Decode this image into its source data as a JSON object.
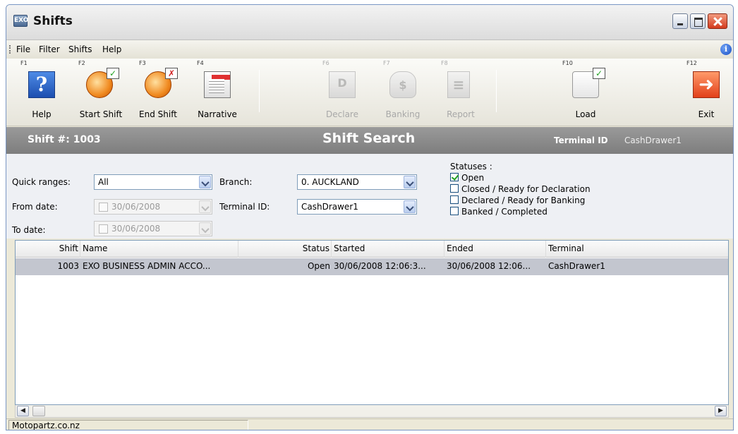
{
  "window": {
    "title": "Shifts",
    "app_icon_text": "EXO"
  },
  "menu": {
    "items": [
      "File",
      "Filter",
      "Shifts",
      "Help"
    ]
  },
  "toolbar": {
    "help": {
      "fkey": "F1",
      "label": "Help",
      "icon": "help-question-icon"
    },
    "start_shift": {
      "fkey": "F2",
      "label": "Start Shift",
      "badge": "✓",
      "icon": "start-shift-clock-icon"
    },
    "end_shift": {
      "fkey": "F3",
      "label": "End Shift",
      "badge": "✗",
      "icon": "end-shift-clock-icon"
    },
    "narrative": {
      "fkey": "F4",
      "label": "Narrative",
      "icon": "narrative-document-icon"
    },
    "declare": {
      "fkey": "F6",
      "label": "Declare",
      "glyph": "D",
      "icon": "declare-icon",
      "enabled": false
    },
    "banking": {
      "fkey": "F7",
      "label": "Banking",
      "glyph": "$",
      "icon": "banking-moneybag-icon",
      "enabled": false
    },
    "report": {
      "fkey": "F8",
      "label": "Report",
      "glyph": "≡",
      "icon": "report-icon",
      "enabled": false
    },
    "load": {
      "fkey": "F10",
      "label": "Load",
      "badge": "✓",
      "icon": "load-shift-icon"
    },
    "exit": {
      "fkey": "F12",
      "label": "Exit",
      "glyph": "➜",
      "icon": "exit-door-icon"
    }
  },
  "banner": {
    "shift_label": "Shift #: 1003",
    "title": "Shift Search",
    "terminal_label": "Terminal ID",
    "terminal_value": "CashDrawer1"
  },
  "filters": {
    "quick_ranges_label": "Quick ranges:",
    "quick_ranges_value": "All",
    "from_date_label": "From date:",
    "from_date_value": "30/06/2008",
    "to_date_label": "To date:",
    "to_date_value": "30/06/2008",
    "branch_label": "Branch:",
    "branch_value": "0. AUCKLAND",
    "terminal_label": "Terminal ID:",
    "terminal_value": "CashDrawer1",
    "statuses_label": "Statuses :",
    "statuses": [
      {
        "label": "Open",
        "checked": true
      },
      {
        "label": "Closed / Ready for Declaration",
        "checked": false
      },
      {
        "label": "Declared / Ready for Banking",
        "checked": false
      },
      {
        "label": "Banked / Completed",
        "checked": false
      }
    ]
  },
  "grid": {
    "columns": [
      "Shift",
      "Name",
      "Status",
      "Started",
      "Ended",
      "Terminal"
    ],
    "rows": [
      {
        "shift": "1003",
        "name": "EXO BUSINESS ADMIN ACCO...",
        "status": "Open",
        "started": "30/06/2008 12:06:3...",
        "ended": "30/06/2008 12:06...",
        "terminal": "CashDrawer1"
      }
    ]
  },
  "statusbar": {
    "text": "Motopartz.co.nz"
  }
}
